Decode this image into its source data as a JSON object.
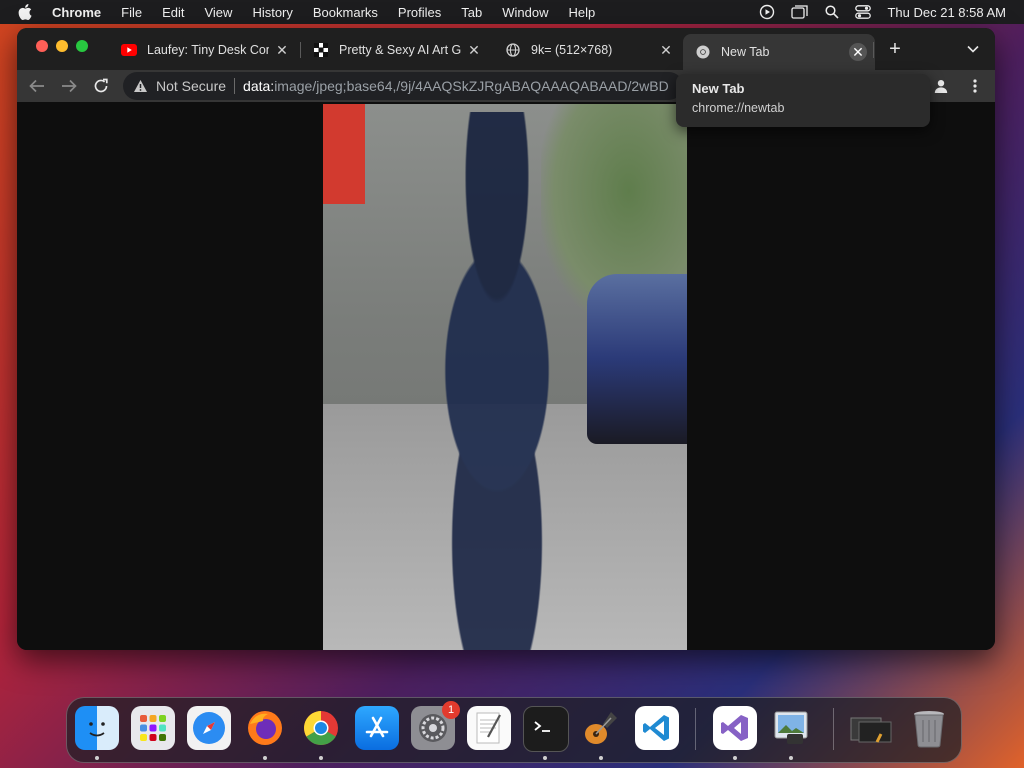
{
  "menubar": {
    "app_name": "Chrome",
    "items": [
      "File",
      "Edit",
      "View",
      "History",
      "Bookmarks",
      "Profiles",
      "Tab",
      "Window",
      "Help"
    ],
    "clock": "Thu Dec 21  8:58 AM"
  },
  "tabs": [
    {
      "title": "Laufey: Tiny Desk Con",
      "favicon": "youtube-icon"
    },
    {
      "title": "Pretty & Sexy AI Art G",
      "favicon": "ai-art-site-icon"
    },
    {
      "title": "9k= (512×768)",
      "favicon": "globe-icon"
    },
    {
      "title": "New Tab",
      "favicon": "chrome-icon"
    }
  ],
  "toolbar": {
    "security_label": "Not Secure",
    "url_scheme": "data:",
    "url_rest": "image/jpeg;base64,/9j/4AAQSkZJRgABAQAAAQABAAD/2wBD"
  },
  "tooltip": {
    "title": "New Tab",
    "url": "chrome://newtab"
  },
  "content": {
    "image_description_icon": "photo-icon"
  },
  "dock": {
    "apps": [
      "Finder",
      "Launchpad",
      "Safari",
      "Firefox",
      "Google Chrome",
      "App Store",
      "System Settings",
      "TextEdit",
      "Terminal",
      "GarageBand",
      "Visual Studio Code",
      "Visual Studio",
      "Preview",
      "Downloads",
      "Trash"
    ],
    "system_settings_badge": "1"
  },
  "colors": {
    "menubar_bg": "#1d1d1f",
    "tabstrip_bg": "#1f1f1f",
    "toolbar_bg": "#363636",
    "content_bg": "#0e0e0e"
  }
}
